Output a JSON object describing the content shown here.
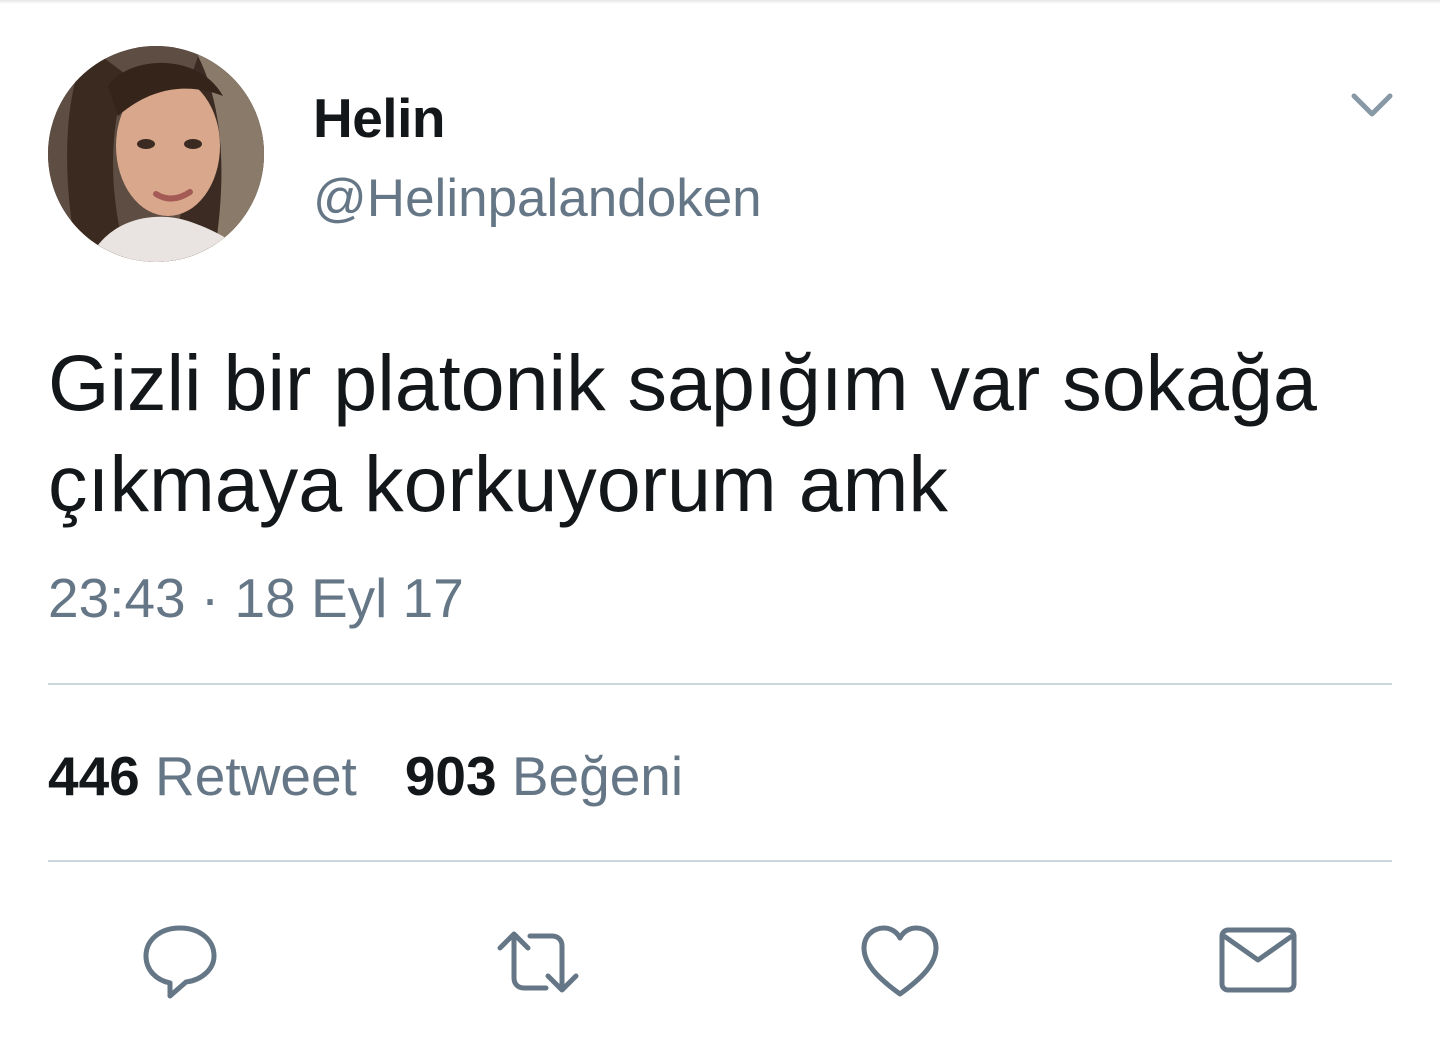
{
  "tweet": {
    "author": {
      "display_name": "Helin",
      "handle": "@Helinpalandoken"
    },
    "text": "Gizli bir platonik sapığım var sokağa çıkmaya korkuyorum amk",
    "timestamp": "23:43 · 18 Eyl 17",
    "stats": {
      "retweets": {
        "count": "446",
        "label": "Retweet"
      },
      "likes": {
        "count": "903",
        "label": "Beğeni"
      }
    }
  },
  "icons": {
    "caret": "chevron-down-icon",
    "reply": "reply-icon",
    "retweet": "retweet-icon",
    "like": "heart-icon",
    "dm": "envelope-icon"
  },
  "colors": {
    "text_primary": "#14171a",
    "text_secondary": "#657786",
    "divider": "#ccd6dd",
    "icon": "#657786"
  }
}
